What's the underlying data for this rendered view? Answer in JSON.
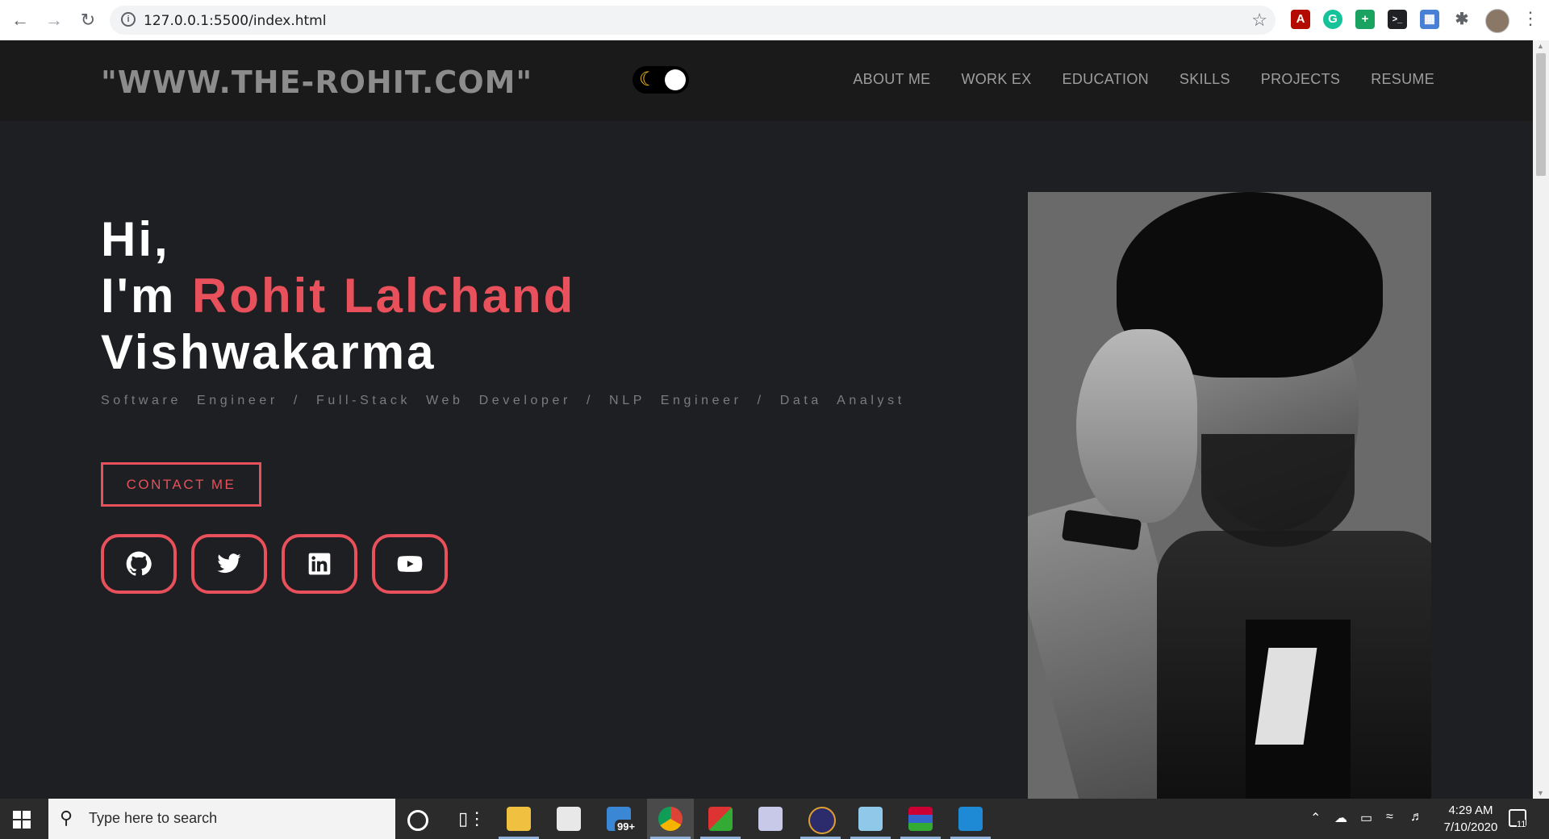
{
  "browser": {
    "url": "127.0.0.1:5500/index.html"
  },
  "site": {
    "logo": "\"WWW.THE-ROHIT.COM\"",
    "nav": [
      "ABOUT ME",
      "WORK EX",
      "EDUCATION",
      "SKILLS",
      "PROJECTS",
      "RESUME"
    ],
    "theme_toggle": {
      "icon": "moon-icon",
      "state": "dark"
    }
  },
  "hero": {
    "greeting": "Hi,",
    "intro": "I'm",
    "name_highlight": "Rohit Lalchand",
    "name_rest": "Vishwakarma",
    "roles": "Software Engineer / Full-Stack Web Developer / NLP Engineer / Data Analyst",
    "contact_label": "CONTACT ME",
    "social": [
      {
        "icon": "github-icon"
      },
      {
        "icon": "twitter-icon"
      },
      {
        "icon": "linkedin-icon"
      },
      {
        "icon": "youtube-icon"
      }
    ],
    "accent": "#e8505b"
  },
  "taskbar": {
    "search_placeholder": "Type here to search",
    "mail_badge": "99+",
    "time": "4:29 AM",
    "date": "7/10/2020",
    "notification_count": "11"
  }
}
